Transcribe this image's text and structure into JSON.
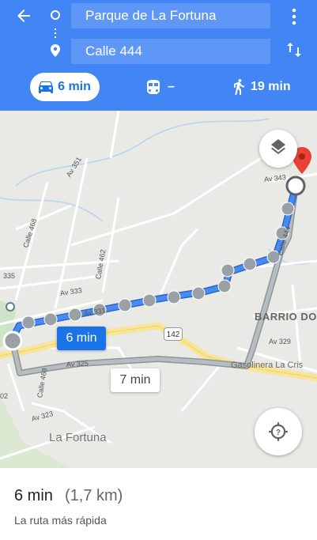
{
  "header": {
    "origin": "Parque de La Fortuna",
    "destination": "Calle 444",
    "modes": [
      {
        "name": "car",
        "label": "6 min"
      },
      {
        "name": "transit",
        "label": "–"
      },
      {
        "name": "walk",
        "label": "19 min"
      }
    ]
  },
  "map": {
    "streets": [
      "Av 351",
      "Calle 468",
      "Calle 462",
      "335",
      "Av 333",
      "Av 331",
      "Av 325",
      "Calle 468",
      "Av 323",
      "02",
      "Av 343",
      "Calle 444",
      "Av 329",
      "142",
      "Gasolinera La Cris"
    ],
    "area_label": "La Fortuna",
    "barrio_label": "BARRIO DO",
    "route_label": "6 min",
    "alt_label": "7 min",
    "colors": {
      "route": "#4285f4",
      "alt_route": "#9aa0a6",
      "pin": "#ea4335",
      "header": "#4285f4"
    }
  },
  "summary": {
    "time": "6 min",
    "distance": "(1,7 km)",
    "description": "La ruta más rápida"
  }
}
